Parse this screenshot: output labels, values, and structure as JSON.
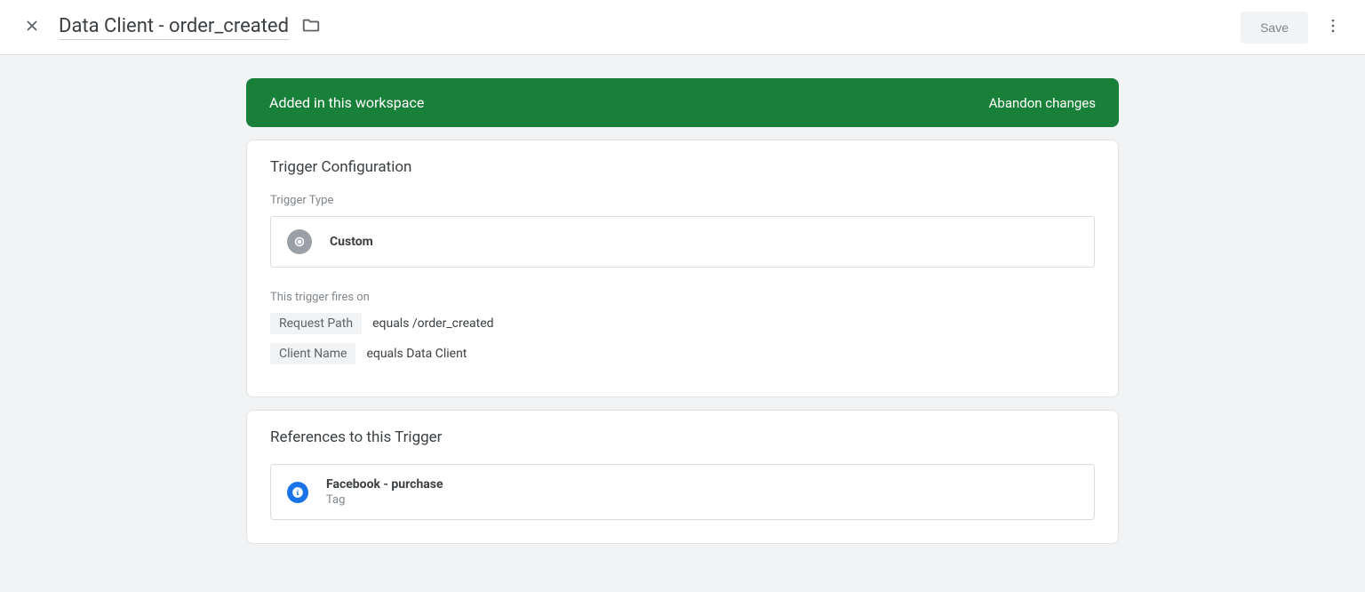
{
  "header": {
    "title": "Data Client - order_created",
    "save_label": "Save"
  },
  "banner": {
    "message": "Added in this workspace",
    "action": "Abandon changes"
  },
  "config": {
    "card_title": "Trigger Configuration",
    "type_label": "Trigger Type",
    "type_value": "Custom",
    "fires_label": "This trigger fires on",
    "conditions": [
      {
        "field": "Request Path",
        "expr": "equals /order_created"
      },
      {
        "field": "Client Name",
        "expr": "equals Data Client"
      }
    ]
  },
  "references": {
    "card_title": "References to this Trigger",
    "items": [
      {
        "name": "Facebook - purchase",
        "type": "Tag"
      }
    ]
  }
}
